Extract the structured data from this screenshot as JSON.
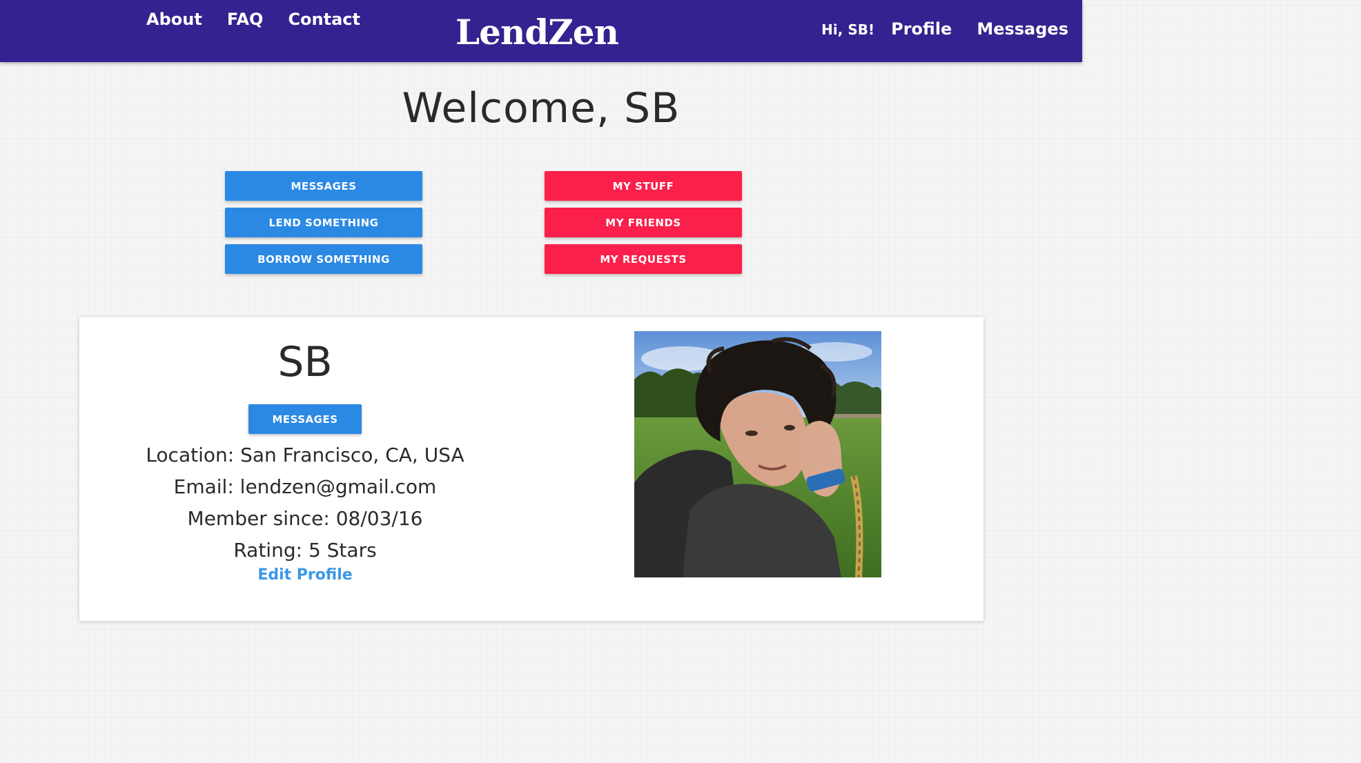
{
  "nav": {
    "left_links": [
      "About",
      "FAQ",
      "Contact"
    ],
    "brand": "LendZen",
    "greeting": "Hi, SB!",
    "right_links": [
      "Profile",
      "Messages"
    ]
  },
  "welcome": "Welcome, SB",
  "actions": {
    "left": [
      "MESSAGES",
      "LEND SOMETHING",
      "BORROW SOMETHING"
    ],
    "right": [
      "MY STUFF",
      "MY FRIENDS",
      "MY REQUESTS"
    ]
  },
  "profile": {
    "name": "SB",
    "messages_button": "MESSAGES",
    "location": "Location: San Francisco, CA, USA",
    "email": "Email: lendzen@gmail.com",
    "member_since": "Member since: 08/03/16",
    "rating": "Rating: 5 Stars",
    "edit_link": "Edit Profile"
  },
  "colors": {
    "navbar": "#33228f",
    "primary_button": "#2b89e4",
    "secondary_button": "#fb1f4b",
    "link": "#3b97e6"
  }
}
